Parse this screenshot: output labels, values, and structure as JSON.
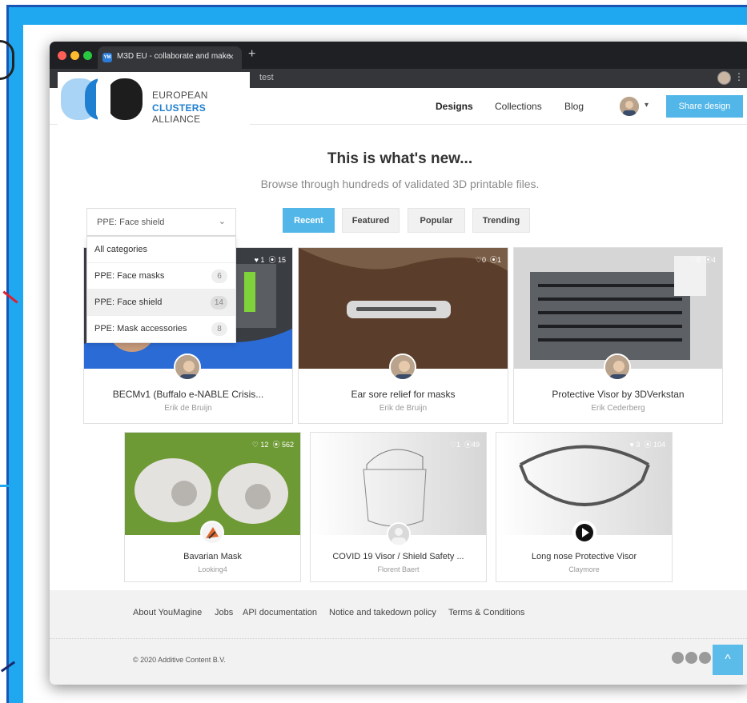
{
  "browser": {
    "tab_title": "M3D EU - collaborate and make",
    "tab_close": "×",
    "new_tab": "+",
    "favicon_text": "YM",
    "url_fragment": "test",
    "menu_glyph": "⋮"
  },
  "logo": {
    "line1": "EUROPEAN",
    "line2_bold": "CLUSTERS",
    "line2_rest": " ALLIANCE"
  },
  "header": {
    "nav": [
      "Designs",
      "Collections",
      "Blog"
    ],
    "avatar_caret": "▾",
    "share_label": "Share design"
  },
  "hero": {
    "title": "This is what's new...",
    "subtitle": "Browse through hundreds of validated 3D printable files."
  },
  "filter": {
    "selected": "PPE: Face shield",
    "chevron": "⌄",
    "options": [
      {
        "label": "All categories",
        "count": ""
      },
      {
        "label": "PPE: Face masks",
        "count": "6"
      },
      {
        "label": "PPE: Face shield",
        "count": "14"
      },
      {
        "label": "PPE: Mask accessories",
        "count": "8"
      }
    ]
  },
  "sort_tabs": [
    "Recent",
    "Featured",
    "Popular",
    "Trending"
  ],
  "designs": [
    {
      "title": "BECMv1 (Buffalo e-NABLE Crisis...",
      "author": "Erik de Bruijn",
      "likes": "1",
      "downloads": "15"
    },
    {
      "title": "Ear sore relief for masks",
      "author": "Erik de Bruijn",
      "likes": "0",
      "downloads": "1"
    },
    {
      "title": "Protective Visor by 3DVerkstan",
      "author": "Erik Cederberg",
      "likes": "0",
      "downloads": "4"
    },
    {
      "title": "Bavarian Mask",
      "author": "Looking4",
      "likes": "12",
      "downloads": "562"
    },
    {
      "title": "COVID 19 Visor / Shield Safety ...",
      "author": "Florent Baert",
      "likes": "1",
      "downloads": "49"
    },
    {
      "title": "Long nose Protective Visor",
      "author": "Claymore",
      "likes": "3",
      "downloads": "104"
    }
  ],
  "stat_icons": {
    "heart": "♡",
    "heart_filled": "♥",
    "download": "⦿"
  },
  "footer": {
    "links": [
      "About YouMagine",
      "Jobs",
      "API documentation",
      "Notice and takedown policy",
      "Terms & Conditions"
    ],
    "copyright": "© 2020 Additive Content B.V.",
    "scroll_top": "^"
  },
  "colors": {
    "accent": "#52b6e8",
    "slide_blue": "#1fa8f0",
    "frame_blue": "#1a55b5"
  }
}
